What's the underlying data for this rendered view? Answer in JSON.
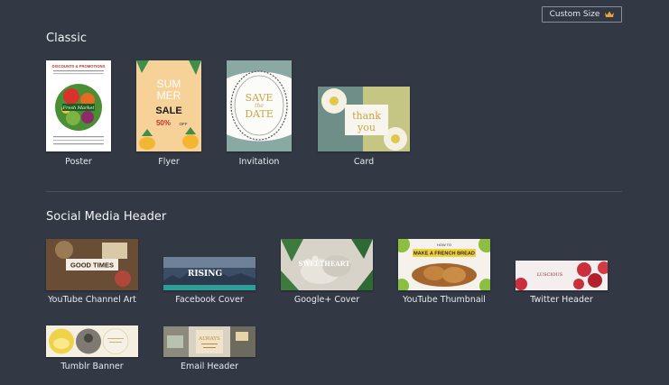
{
  "header": {
    "custom_size_label": "Custom Size",
    "custom_size_icon": "crown-icon",
    "accent": "#e8a33d"
  },
  "sections": [
    {
      "title": "Classic",
      "items": [
        {
          "label": "Poster",
          "thumb_text": [
            "DISCOUNTS & PROMOTIONS",
            "Fresh Market"
          ]
        },
        {
          "label": "Flyer",
          "thumb_text": [
            "SUM",
            "MER",
            "SALE",
            "50%",
            "OFF"
          ]
        },
        {
          "label": "Invitation",
          "thumb_text": [
            "SAVE",
            "the",
            "DATE"
          ]
        },
        {
          "label": "Card",
          "thumb_text": [
            "thank",
            "you"
          ]
        }
      ]
    },
    {
      "title": "Social Media Header",
      "items": [
        {
          "label": "YouTube Channel Art",
          "thumb_text": [
            "GOOD TIMES"
          ]
        },
        {
          "label": "Facebook Cover",
          "thumb_text": [
            "RISING"
          ]
        },
        {
          "label": "Google+ Cover",
          "thumb_text": [
            "SWEETHEART"
          ]
        },
        {
          "label": "YouTube Thumbnail",
          "thumb_text": [
            "HOW TO",
            "MAKE A FRENCH BREAD"
          ]
        },
        {
          "label": "Twitter Header",
          "thumb_text": [
            "LUSCIOUS"
          ]
        },
        {
          "label": "Tumblr Banner",
          "thumb_text": []
        },
        {
          "label": "Email Header",
          "thumb_text": [
            "ALWAYS"
          ]
        }
      ]
    }
  ]
}
